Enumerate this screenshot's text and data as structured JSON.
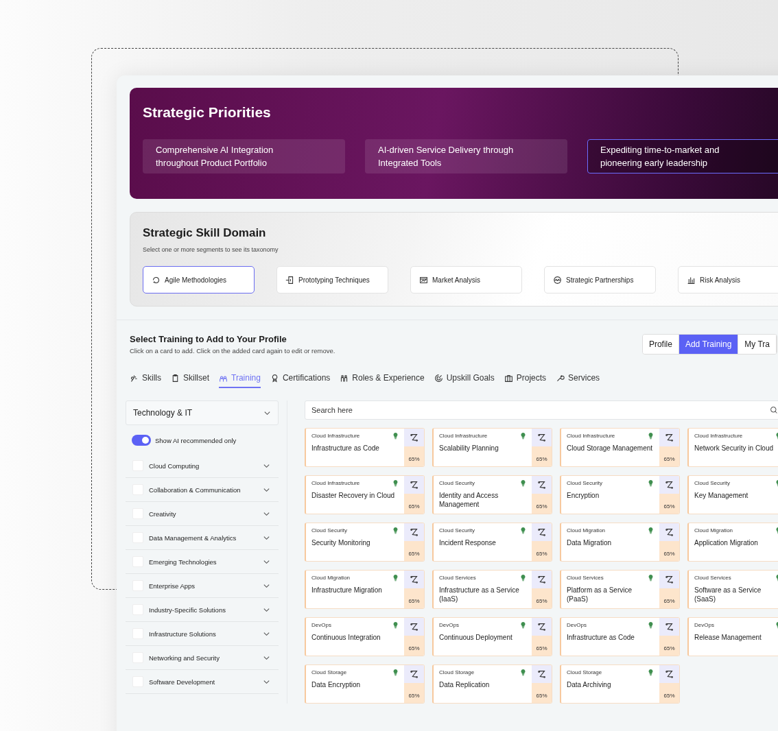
{
  "banner": {
    "title": "Strategic Priorities",
    "priorities": [
      {
        "label": "Comprehensive AI Integration throughout Product Portfolio",
        "selected": false
      },
      {
        "label": "AI-driven Service Delivery through Integrated Tools",
        "selected": false
      },
      {
        "label": "Expediting time-to-market and pioneering early leadership",
        "selected": true
      }
    ]
  },
  "skill_domain": {
    "title": "Strategic Skill Domain",
    "subtitle": "Select one or more segments to see its taxonomy",
    "segments": [
      {
        "label": "Agile Methodologies",
        "selected": true
      },
      {
        "label": "Prototyping Techniques",
        "selected": false
      },
      {
        "label": "Market Analysis",
        "selected": false
      },
      {
        "label": "Strategic Partnerships",
        "selected": false
      },
      {
        "label": "Risk Analysis",
        "selected": false
      }
    ]
  },
  "training": {
    "title": "Select Training to Add to Your Profile",
    "subtitle": "Click on a card to add. Click on the added card again to edit or remove.",
    "view_switch": [
      {
        "label": "Profile",
        "selected": false
      },
      {
        "label": "Add Training",
        "selected": true
      },
      {
        "label": "My Tra",
        "selected": false
      }
    ],
    "tabs": [
      {
        "label": "Skills",
        "selected": false
      },
      {
        "label": "Skillset",
        "selected": false
      },
      {
        "label": "Training",
        "selected": true
      },
      {
        "label": "Certifications",
        "selected": false
      },
      {
        "label": "Roles & Experience",
        "selected": false
      },
      {
        "label": "Upskill Goals",
        "selected": false
      },
      {
        "label": "Projects",
        "selected": false
      },
      {
        "label": "Services",
        "selected": false
      }
    ]
  },
  "sidebar": {
    "dropdown": "Technology & IT",
    "ai_toggle": {
      "label": "Show AI recommended only",
      "on": true
    },
    "categories": [
      {
        "label": "Cloud Computing",
        "checked": false
      },
      {
        "label": "Collaboration & Communication",
        "checked": false
      },
      {
        "label": "Creativity",
        "checked": false
      },
      {
        "label": "Data Management & Analytics",
        "checked": false
      },
      {
        "label": "Emerging Technologies",
        "checked": false
      },
      {
        "label": "Enterprise Apps",
        "checked": false
      },
      {
        "label": "Industry-Specific Solutions",
        "checked": false
      },
      {
        "label": "Infrastructure Solutions",
        "checked": false
      },
      {
        "label": "Networking and Security",
        "checked": false
      },
      {
        "label": "Software Development",
        "checked": false
      }
    ]
  },
  "search": {
    "placeholder": "Search here"
  },
  "cards": [
    {
      "category": "Cloud Infrastructure",
      "title": "Infrastructure as Code",
      "percent": "65%"
    },
    {
      "category": "Cloud Infrastructure",
      "title": "Scalability Planning",
      "percent": "65%"
    },
    {
      "category": "Cloud Infrastructure",
      "title": "Cloud Storage Management",
      "percent": "65%"
    },
    {
      "category": "Cloud Infrastructure",
      "title": "Network Security in Cloud"
    },
    {
      "category": "Cloud Infrastructure",
      "title": "Disaster Recovery in Cloud",
      "percent": "65%"
    },
    {
      "category": "Cloud Security",
      "title": "Identity and Access Management",
      "percent": "65%"
    },
    {
      "category": "Cloud Security",
      "title": "Encryption",
      "percent": "65%"
    },
    {
      "category": "Cloud Security",
      "title": "Key Management"
    },
    {
      "category": "Cloud Security",
      "title": "Security Monitoring",
      "percent": "65%"
    },
    {
      "category": "Cloud Security",
      "title": "Incident Response",
      "percent": "65%"
    },
    {
      "category": "Cloud Migration",
      "title": "Data Migration",
      "percent": "65%"
    },
    {
      "category": "Cloud Migration",
      "title": "Application Migration"
    },
    {
      "category": "Cloud Migration",
      "title": "Infrastructure Migration",
      "percent": "65%"
    },
    {
      "category": "Cloud Services",
      "title": "Infrastructure as a Service (IaaS)",
      "percent": "65%"
    },
    {
      "category": "Cloud Services",
      "title": "Platform as a Service (PaaS)",
      "percent": "65%"
    },
    {
      "category": "Cloud Services",
      "title": "Software as a Service (SaaS)"
    },
    {
      "category": "DevOps",
      "title": "Continuous Integration",
      "percent": "65%"
    },
    {
      "category": "DevOps",
      "title": "Continuous Deployment",
      "percent": "65%"
    },
    {
      "category": "DevOps",
      "title": "Infrastructure as Code",
      "percent": "65%"
    },
    {
      "category": "DevOps",
      "title": "Release Management"
    },
    {
      "category": "Cloud Storage",
      "title": "Data Encryption",
      "percent": "65%"
    },
    {
      "category": "Cloud Storage",
      "title": "Data Replication",
      "percent": "65%"
    },
    {
      "category": "Cloud Storage",
      "title": "Data Archiving",
      "percent": "65%"
    }
  ]
}
